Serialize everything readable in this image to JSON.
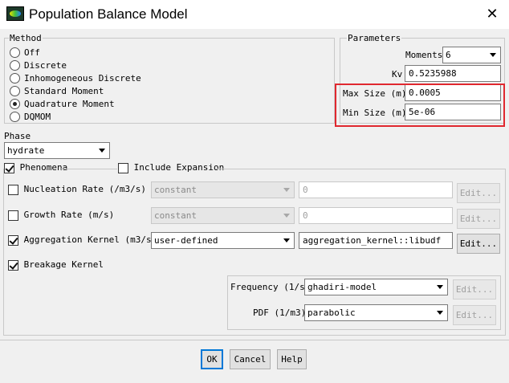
{
  "window": {
    "title": "Population Balance Model"
  },
  "method": {
    "legend": "Method",
    "options": [
      "Off",
      "Discrete",
      "Inhomogeneous Discrete",
      "Standard Moment",
      "Quadrature Moment",
      "DQMOM"
    ],
    "selected": "Quadrature Moment"
  },
  "parameters": {
    "legend": "Parameters",
    "moments_label": "Moments",
    "moments_value": "6",
    "kv_label": "Kv",
    "kv_value": "0.5235988",
    "max_size_label": "Max Size (m)",
    "max_size_value": "0.0005",
    "min_size_label": "Min Size (m)",
    "min_size_value": "5e-06"
  },
  "phase": {
    "label": "Phase",
    "value": "hydrate"
  },
  "phenomena": {
    "label": "Phenomena",
    "checked": true
  },
  "include_expansion": {
    "label": "Include Expansion",
    "checked": false
  },
  "nucleation": {
    "label": "Nucleation Rate (/m3/s)",
    "checked": false,
    "method": "constant",
    "value": "0",
    "edit": "Edit..."
  },
  "growth": {
    "label": "Growth Rate (m/s)",
    "checked": false,
    "method": "constant",
    "value": "0",
    "edit": "Edit..."
  },
  "aggregation": {
    "label": "Aggregation Kernel (m3/s)",
    "checked": true,
    "method": "user-defined",
    "value": "aggregation_kernel::libudf",
    "edit": "Edit..."
  },
  "breakage": {
    "label": "Breakage Kernel",
    "checked": true,
    "frequency_label": "Frequency (1/s)",
    "frequency_value": "ghadiri-model",
    "frequency_edit": "Edit...",
    "pdf_label": "PDF (1/m3)",
    "pdf_value": "parabolic",
    "pdf_edit": "Edit..."
  },
  "buttons": {
    "ok": "OK",
    "cancel": "Cancel",
    "help": "Help"
  },
  "colors": {
    "highlight": "#e0282f",
    "focus": "#0078d7"
  }
}
